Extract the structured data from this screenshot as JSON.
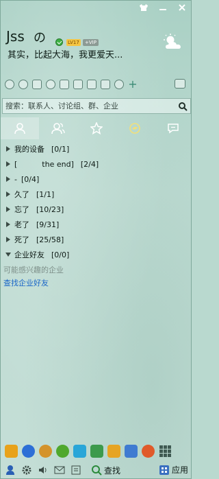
{
  "profile": {
    "nickname": "Jss",
    "nickname_symbol": "の",
    "level_badge": "LV17",
    "vip_badge": "+VIP",
    "signature": "其实，比起大海，我更爱天..."
  },
  "search": {
    "placeholder": "搜索：联系人、讨论组、群、企业"
  },
  "tabs": [
    {
      "icon": "contacts-icon",
      "active": true
    },
    {
      "icon": "group-icon",
      "active": false
    },
    {
      "icon": "star-icon",
      "active": false
    },
    {
      "icon": "qzone-icon",
      "active": false
    },
    {
      "icon": "recent-chat-icon",
      "active": false
    }
  ],
  "groups": [
    {
      "name": "我的设备",
      "count": "[0/1]",
      "expanded": false
    },
    {
      "name": "[",
      "middle": "the end]",
      "count": "[2/4]",
      "expanded": false
    },
    {
      "name": "-",
      "count": "[0/4]",
      "expanded": false
    },
    {
      "name": "久了",
      "count": "[1/1]",
      "expanded": false
    },
    {
      "name": "忘了",
      "count": "[10/23]",
      "expanded": false
    },
    {
      "name": "老了",
      "count": "[9/31]",
      "expanded": false
    },
    {
      "name": "死了",
      "count": "[25/58]",
      "expanded": false
    },
    {
      "name": "企业好友",
      "count": "[0/0]",
      "expanded": true
    }
  ],
  "enterprise": {
    "hint": "可能感兴趣的企业",
    "link": "查找企业好友"
  },
  "footer": {
    "find_label": "查找",
    "apps_label": "应用"
  },
  "colors": {
    "accent_link": "#1a66c8",
    "status_online": "#3cb043"
  }
}
